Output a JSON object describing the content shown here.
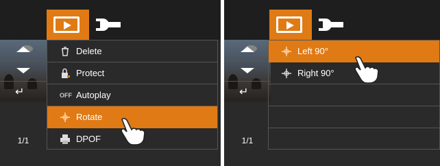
{
  "left": {
    "menu_items": [
      {
        "label": "Delete",
        "icon": "trash-icon"
      },
      {
        "label": "Protect",
        "icon": "lock-icon"
      },
      {
        "label": "Autoplay",
        "icon": "off-icon",
        "icon_text": "OFF"
      },
      {
        "label": "Rotate",
        "icon": "rotate-icon"
      },
      {
        "label": "DPOF",
        "icon": "print-icon"
      }
    ],
    "selected": "Rotate",
    "counter": "1/1"
  },
  "right": {
    "menu_items": [
      {
        "label": "Left 90°",
        "icon": "rotate-icon"
      },
      {
        "label": "Right 90°",
        "icon": "rotate-icon"
      }
    ],
    "selected": "Left 90°",
    "counter": "1/1"
  },
  "colors": {
    "accent": "#e07a14",
    "background": "#2a2a2a",
    "text": "#ffffff"
  }
}
